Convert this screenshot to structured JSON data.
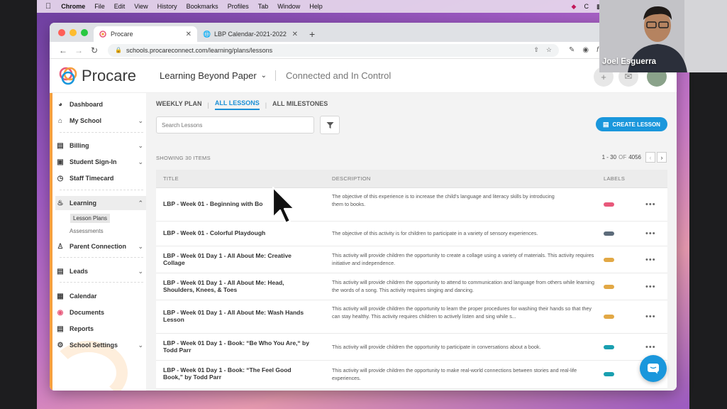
{
  "mac_menubar": {
    "app_name": "Chrome",
    "items": [
      "File",
      "Edit",
      "View",
      "History",
      "Bookmarks",
      "Profiles",
      "Tab",
      "Window",
      "Help"
    ]
  },
  "browser": {
    "tabs": [
      {
        "title": "Procare",
        "active": true
      },
      {
        "title": "LBP Calendar-2021-2022",
        "active": false
      }
    ],
    "url": "schools.procareconnect.com/learning/plans/lessons"
  },
  "app_header": {
    "logo_text": "Procare",
    "school_name": "Learning Beyond Paper",
    "tagline": "Connected and In Control"
  },
  "sidebar": {
    "items": [
      {
        "label": "Dashboard",
        "icon": "dashboard-icon"
      },
      {
        "label": "My School",
        "icon": "school-icon",
        "expandable": true
      },
      {
        "label": "Billing",
        "icon": "billing-icon",
        "expandable": true
      },
      {
        "label": "Student Sign-In",
        "icon": "sign-in-icon",
        "expandable": true
      },
      {
        "label": "Staff Timecard",
        "icon": "timecard-icon"
      },
      {
        "label": "Learning",
        "icon": "learning-icon",
        "expandable": true,
        "expanded": true
      },
      {
        "label": "Parent Connection",
        "icon": "parent-icon",
        "expandable": true
      },
      {
        "label": "Leads",
        "icon": "leads-icon",
        "expandable": true
      },
      {
        "label": "Calendar",
        "icon": "calendar-icon"
      },
      {
        "label": "Documents",
        "icon": "documents-icon"
      },
      {
        "label": "Reports",
        "icon": "reports-icon"
      },
      {
        "label": "School Settings",
        "icon": "settings-icon",
        "expandable": true
      }
    ],
    "learning_sub": [
      "Lesson Plans",
      "Assessments"
    ]
  },
  "main": {
    "subtabs": [
      "WEEKLY PLAN",
      "ALL LESSONS",
      "ALL MILESTONES"
    ],
    "active_subtab": "ALL LESSONS",
    "search_placeholder": "Search Lessons",
    "create_button": "CREATE LESSON",
    "showing": "SHOWING 30 ITEMS",
    "pager": {
      "range": "1 - 30",
      "of": "OF",
      "total": "4056"
    },
    "columns": [
      "TITLE",
      "DESCRIPTION",
      "LABELS"
    ],
    "rows": [
      {
        "title": "LBP - Week 01 - Beginning with Bo",
        "description": "The objective of this experience is to increase the child's language and literacy skills by introducing\nthem to books.",
        "label_color": "#e8587a"
      },
      {
        "title": "LBP - Week 01 - Colorful Playdough",
        "description": "The objective of this activity is for children to participate in a variety of sensory experiences.",
        "label_color": "#5c6b7a"
      },
      {
        "title": "LBP - Week 01 Day 1 - All About Me: Creative Collage",
        "description": "This activity will provide children the opportunity to create a collage using a variety of materials. This activity requires initiative and independence.",
        "label_color": "#e2a845"
      },
      {
        "title": "LBP - Week 01 Day 1 - All About Me: Head, Shoulders, Knees, & Toes",
        "description": "This activity will provide children the opportunity to attend to communication and language from others while learning the words of a song. This activity requires singing and dancing.",
        "label_color": "#e2a845"
      },
      {
        "title": "LBP - Week 01 Day 1 - All About Me: Wash Hands Lesson",
        "description": "This activity will provide children the opportunity to learn the proper procedures for washing their hands so that they can stay healthy. This activity requires children to actively listen and sing while s...",
        "label_color": "#e2a845"
      },
      {
        "title": "LBP - Week 01 Day 1 - Book: “Be Who You Are,“ by Todd Parr",
        "description": "This activity will provide children the opportunity to participate in conversations about a book.",
        "label_color": "#1a9fb0"
      },
      {
        "title": "LBP - Week 01 Day 1 - Book: “The Feel Good Book,” by Todd Parr",
        "description": "This activity will provide children the opportunity to make real-world connections between stories and real-life experiences.",
        "label_color": "#1a9fb0"
      }
    ]
  },
  "webcam": {
    "name": "Joel Esguerra"
  }
}
